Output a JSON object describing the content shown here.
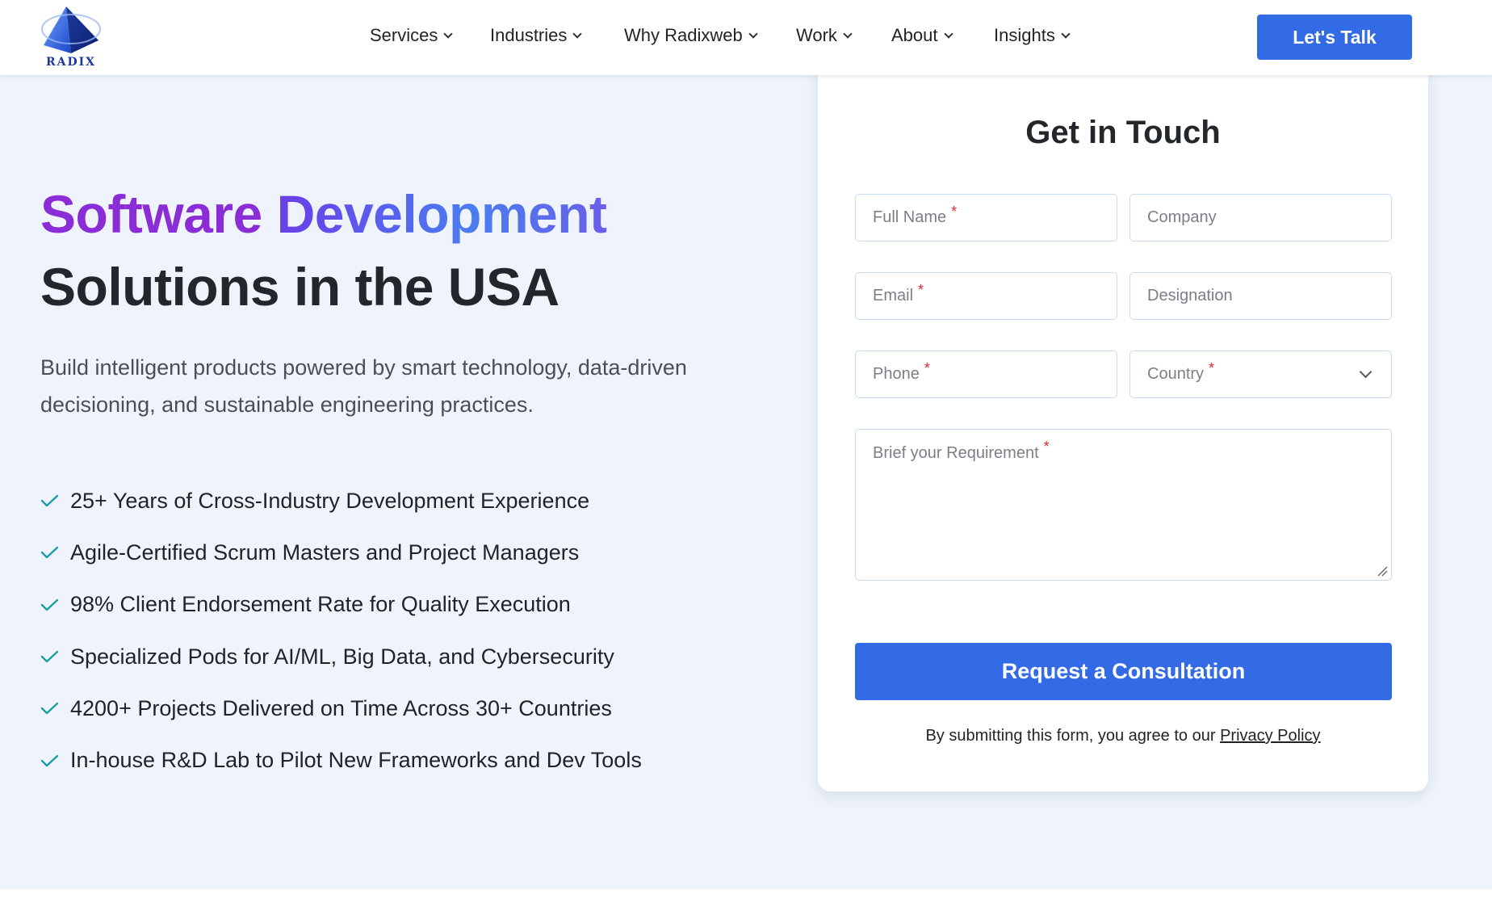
{
  "brand": {
    "name": "RADIX",
    "primary": "#336be6",
    "title_purple": "#8a2dd6",
    "check_color": "#1f9aa8"
  },
  "nav": {
    "items": [
      {
        "label": "Services"
      },
      {
        "label": "Industries"
      },
      {
        "label": "Why Radixweb"
      },
      {
        "label": "Work"
      },
      {
        "label": "About"
      },
      {
        "label": "Insights"
      }
    ],
    "cta_label": "Let's Talk"
  },
  "hero": {
    "title_word_1": "Software",
    "title_word_2": "Development",
    "title_line_2": "Solutions in the USA",
    "subtitle": "Build intelligent products powered by smart technology, data-driven decisioning, and sustainable engineering practices.",
    "features": [
      "25+ Years of Cross-Industry Development Experience",
      "Agile-Certified Scrum Masters and Project Managers",
      "98% Client Endorsement Rate for Quality Execution",
      "Specialized Pods for AI/ML, Big Data, and Cybersecurity",
      "4200+ Projects Delivered on Time Across 30+ Countries",
      "In-house R&D Lab to Pilot New Frameworks and Dev Tools"
    ]
  },
  "form": {
    "title": "Get in Touch",
    "required_mark": "*",
    "full_name_placeholder": "Full Name",
    "company_placeholder": "Company",
    "email_placeholder": "Email",
    "designation_placeholder": "Designation",
    "phone_placeholder": "Phone",
    "country_placeholder": "Country",
    "requirement_placeholder": "Brief your Requirement",
    "submit_label": "Request a Consultation",
    "consent_text": "By submitting this form, you agree to our",
    "privacy_link": "Privacy Policy"
  }
}
